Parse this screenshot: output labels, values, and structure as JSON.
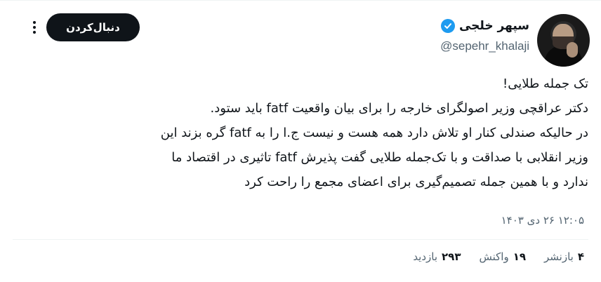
{
  "user": {
    "display_name": "سپهر خلجی",
    "username": "@sepehr_khalaji",
    "verified": true
  },
  "actions": {
    "follow_label": "دنبال‌کردن",
    "more_icon": "more-vertical-icon"
  },
  "tweet": {
    "lines": [
      "تک جمله طلایی!",
      "دکتر عراقچی وزیر اصولگرای خارجه را برای بیان واقعیت fatf باید ستود.",
      "در حالیکه صندلی کنار او تلاش دارد همه هست و نیست ج.ا را به fatf گره بزند این",
      "وزیر انقلابی با صداقت و با تک‌جمله طلایی گفت پذیرش fatf تاثیری در اقتصاد ما",
      "ندارد و با همین جمله تصمیم‌گیری برای اعضای مجمع را راحت کرد"
    ],
    "timestamp": "۱۲:۰۵ ۲۶ دی ۱۴۰۳"
  },
  "stats": {
    "reposts_num": "۴",
    "reposts_label": "بازنشر",
    "reactions_num": "۱۹",
    "reactions_label": "واکنش",
    "views_num": "۲۹۳",
    "views_label": "بازدید"
  },
  "colors": {
    "text_primary": "#0f1419",
    "text_secondary": "#536471",
    "verified_blue": "#1d9bf0",
    "button_bg": "#0f1419"
  }
}
